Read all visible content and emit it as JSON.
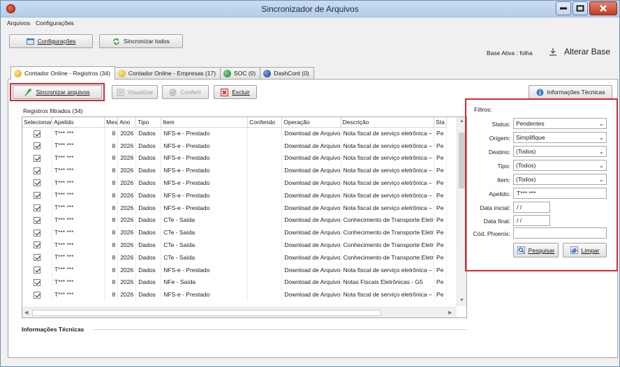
{
  "window": {
    "title": "Sincronizador de Arquivos"
  },
  "menu": [
    "Arquivos",
    "Configurações"
  ],
  "toolbar": {
    "config_label": "Configurações",
    "sync_all_label": "Sincronizar todos"
  },
  "base": {
    "label": "Base Ativa : folha",
    "change_label": "Alterar Base"
  },
  "tabs": [
    {
      "label": "Contador Online - Registros (34)",
      "icon": "coin-icon",
      "color": "#f1c232"
    },
    {
      "label": "Contador Online - Empresas (17)",
      "icon": "coin-icon",
      "color": "#f1c232"
    },
    {
      "label": "SOC (0)",
      "icon": "soc-icon",
      "color": "#2f9a43"
    },
    {
      "label": "DashCont (0)",
      "icon": "dashcont-icon",
      "color": "#234f9a"
    }
  ],
  "actions": {
    "sync_files": "Sincronizar arquivos",
    "view": "Visualizar",
    "check": "Conferir",
    "delete": "Excluir",
    "tech_info": "Informações Técnicas"
  },
  "grid": {
    "group_title": "Registros filtrados (34)",
    "columns": [
      "Selecionar",
      "Apelido",
      "Mes",
      "Ano",
      "Tipo",
      "Item",
      "Conferido",
      "Operação",
      "Descrição",
      "Sta"
    ],
    "rows": [
      {
        "apelido": "T*** ***",
        "mes": "8",
        "ano": "2026",
        "tipo": "Dados",
        "item": "NFS-e - Prestado",
        "conferido": "",
        "operacao": "Download de Arquivo",
        "descricao": "Nota fiscal de serviço eletrônica –",
        "status": "Pe"
      },
      {
        "apelido": "T*** ***",
        "mes": "8",
        "ano": "2026",
        "tipo": "Dados",
        "item": "NFS-e - Prestado",
        "conferido": "",
        "operacao": "Download de Arquivo",
        "descricao": "Nota fiscal de serviço eletrônica –",
        "status": "Pe"
      },
      {
        "apelido": "T*** ***",
        "mes": "8",
        "ano": "2026",
        "tipo": "Dados",
        "item": "NFS-e - Prestado",
        "conferido": "",
        "operacao": "Download de Arquivo",
        "descricao": "Nota fiscal de serviço eletrônica –",
        "status": "Pe"
      },
      {
        "apelido": "T*** ***",
        "mes": "8",
        "ano": "2026",
        "tipo": "Dados",
        "item": "NFS-e - Prestado",
        "conferido": "",
        "operacao": "Download de Arquivo",
        "descricao": "Nota fiscal de serviço eletrônica –",
        "status": "Pe"
      },
      {
        "apelido": "T*** ***",
        "mes": "8",
        "ano": "2026",
        "tipo": "Dados",
        "item": "NFS-e - Prestado",
        "conferido": "",
        "operacao": "Download de Arquivo",
        "descricao": "Nota fiscal de serviço eletrônica –",
        "status": "Pe"
      },
      {
        "apelido": "T*** ***",
        "mes": "8",
        "ano": "2026",
        "tipo": "Dados",
        "item": "NFS-e - Prestado",
        "conferido": "",
        "operacao": "Download de Arquivo",
        "descricao": "Nota fiscal de serviço eletrônica –",
        "status": "Pe"
      },
      {
        "apelido": "T*** ***",
        "mes": "8",
        "ano": "2026",
        "tipo": "Dados",
        "item": "NFS-e - Prestado",
        "conferido": "",
        "operacao": "Download de Arquivo",
        "descricao": "Nota fiscal de serviço eletrônica –",
        "status": "Pe"
      },
      {
        "apelido": "T*** ***",
        "mes": "8",
        "ano": "2026",
        "tipo": "Dados",
        "item": "CTe - Saída",
        "conferido": "",
        "operacao": "Download de Arquivo",
        "descricao": "Conhecimento de Transporte Eletr",
        "status": "Pe"
      },
      {
        "apelido": "T*** ***",
        "mes": "8",
        "ano": "2026",
        "tipo": "Dados",
        "item": "CTe - Saída",
        "conferido": "",
        "operacao": "Download de Arquivo",
        "descricao": "Conhecimento de Transporte Eletr",
        "status": "Pe"
      },
      {
        "apelido": "T*** ***",
        "mes": "8",
        "ano": "2026",
        "tipo": "Dados",
        "item": "CTe - Saída",
        "conferido": "",
        "operacao": "Download de Arquivo",
        "descricao": "Conhecimento de Transporte Eletr",
        "status": "Pe"
      },
      {
        "apelido": "T*** ***",
        "mes": "8",
        "ano": "2026",
        "tipo": "Dados",
        "item": "CTe - Saída",
        "conferido": "",
        "operacao": "Download de Arquivo",
        "descricao": "Conhecimento de Transporte Eletr",
        "status": "Pe"
      },
      {
        "apelido": "T*** ***",
        "mes": "8",
        "ano": "2026",
        "tipo": "Dados",
        "item": "NFS-e - Prestado",
        "conferido": "",
        "operacao": "Download de Arquivo",
        "descricao": "Nota fiscal de serviço eletrônica –",
        "status": "Pe"
      },
      {
        "apelido": "T*** ***",
        "mes": "8",
        "ano": "2026",
        "tipo": "Dados",
        "item": "NFe - Saída",
        "conferido": "",
        "operacao": "Download de Arquivo",
        "descricao": "Notas Fiscais Eletrônicas - G5",
        "status": "Pe"
      },
      {
        "apelido": "T*** ***",
        "mes": "8",
        "ano": "2026",
        "tipo": "Dados",
        "item": "NFS-e - Prestado",
        "conferido": "",
        "operacao": "Download de Arquivo",
        "descricao": "Nota fiscal de serviço eletrônica –",
        "status": "Pe"
      }
    ]
  },
  "info_section": {
    "title": "Informações Técnicas"
  },
  "filters": {
    "title": "Filtros:",
    "status": {
      "label": "Status:",
      "value": "Pendentes"
    },
    "origem": {
      "label": "Origem:",
      "value": "Simplifique"
    },
    "destino": {
      "label": "Destino:",
      "value": "(Todos)"
    },
    "tipo": {
      "label": "Tipo:",
      "value": "(Todos)"
    },
    "item": {
      "label": "Item:",
      "value": "(Todos)"
    },
    "apelido": {
      "label": "Apelido:",
      "value": "T*** ***"
    },
    "data_inicial": {
      "label": "Data inicial:",
      "value": " / /"
    },
    "data_final": {
      "label": "Data final:",
      "value": " / /"
    },
    "cod_phoenix": {
      "label": "Cód. Phoenix:",
      "value": ""
    },
    "search_label": "Pesquisar",
    "clear_label": "Limpar"
  },
  "colors": {
    "highlight": "#d9262f",
    "title_bar": "#c9dcf1"
  }
}
